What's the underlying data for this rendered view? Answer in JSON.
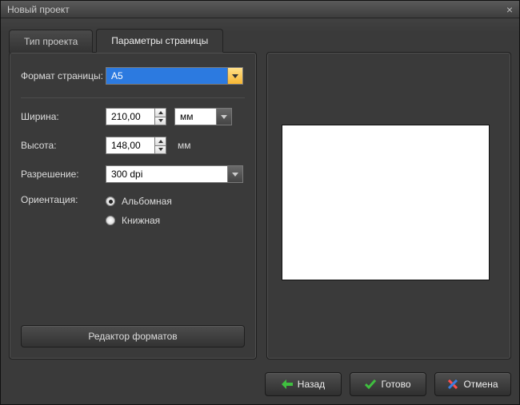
{
  "window": {
    "title": "Новый проект"
  },
  "tabs": {
    "project_type": "Тип проекта",
    "page_params": "Параметры страницы"
  },
  "labels": {
    "page_format": "Формат страницы:",
    "width": "Ширина:",
    "height": "Высота:",
    "resolution": "Разрешение:",
    "orientation": "Ориентация:"
  },
  "values": {
    "page_format": "A5",
    "width": "210,00",
    "height": "148,00",
    "unit": "мм",
    "height_unit": "мм",
    "resolution": "300 dpi"
  },
  "orientation": {
    "landscape": "Альбомная",
    "portrait": "Книжная",
    "selected": "landscape"
  },
  "buttons": {
    "format_editor": "Редактор форматов",
    "back": "Назад",
    "done": "Готово",
    "cancel": "Отмена"
  },
  "icons": {
    "back_color": "#3fbf3f",
    "done_color": "#3fbf3f",
    "cancel_color1": "#ff4d4d",
    "cancel_color2": "#3a7de0"
  }
}
